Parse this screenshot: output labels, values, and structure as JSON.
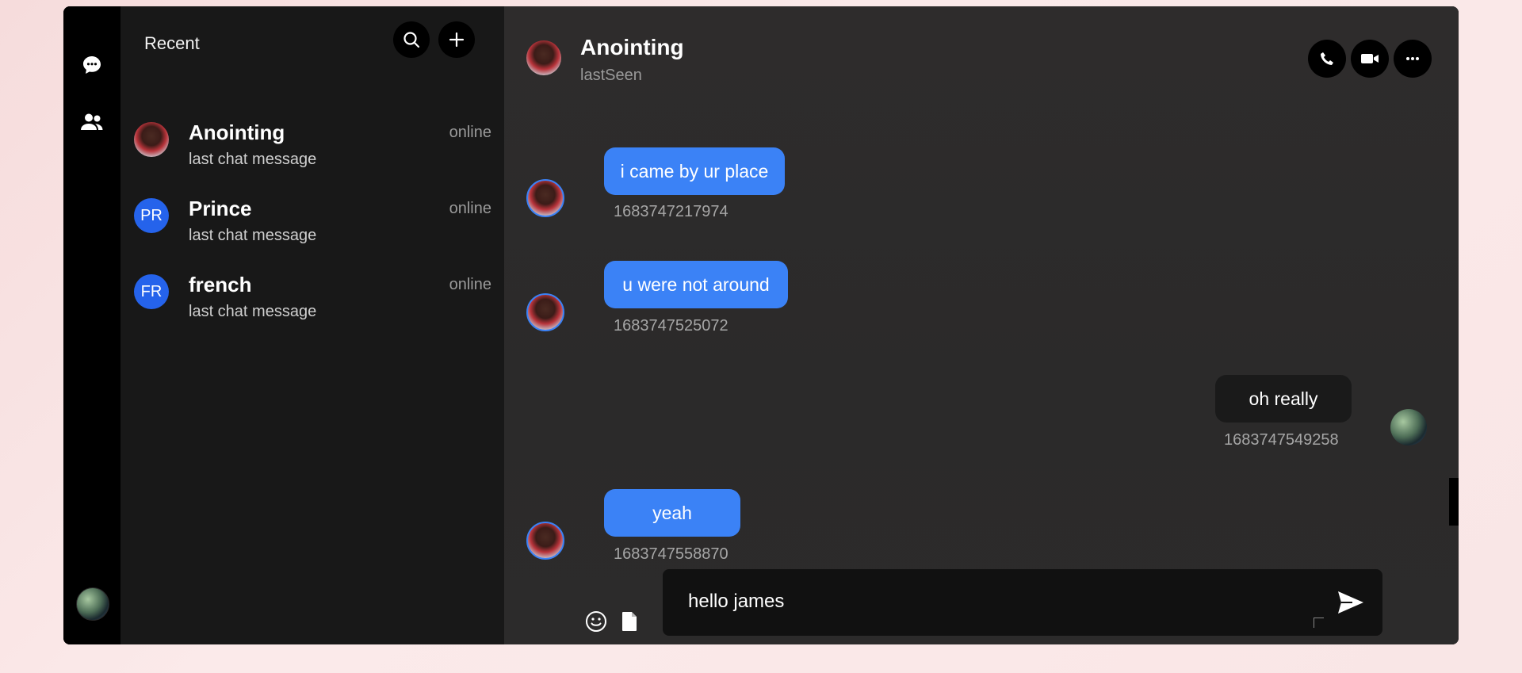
{
  "sidebar": {
    "title": "Recent",
    "chats": [
      {
        "name": "Anointing",
        "status": "online",
        "last": "last chat message",
        "avatar": "photo",
        "initials": ""
      },
      {
        "name": "Prince",
        "status": "online",
        "last": "last chat message",
        "avatar": "initials",
        "initials": "PR"
      },
      {
        "name": "french",
        "status": "online",
        "last": "last chat message",
        "avatar": "initials",
        "initials": "FR"
      }
    ]
  },
  "rail": {
    "icons": [
      "chat-bubble-icon",
      "users-icon"
    ]
  },
  "header": {
    "name": "Anointing",
    "subtitle": "lastSeen"
  },
  "messages": [
    {
      "text": "i came by ur place",
      "time": "1683747217974",
      "side": "in"
    },
    {
      "text": "u were not around",
      "time": "1683747525072",
      "side": "in"
    },
    {
      "text": "oh really",
      "time": "1683747549258",
      "side": "out"
    },
    {
      "text": "yeah",
      "time": "1683747558870",
      "side": "in"
    }
  ],
  "composer": {
    "value": "hello james"
  },
  "colors": {
    "accent": "#3b82f6",
    "initials_bg": "#2563eb",
    "sidebar_bg": "#181818",
    "rail_bg": "#000000"
  }
}
